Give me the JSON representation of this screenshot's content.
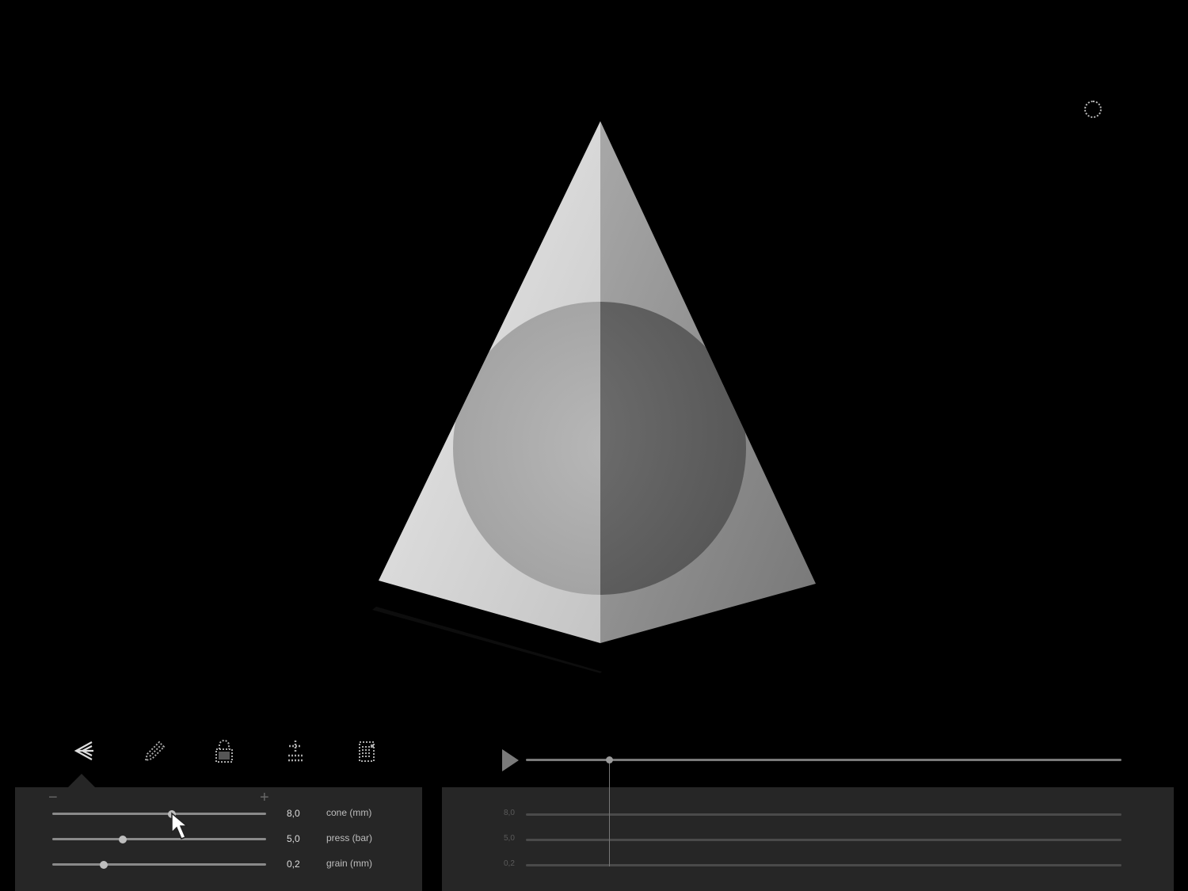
{
  "tools": [
    {
      "name": "back",
      "icon": "back-arrows-icon"
    },
    {
      "name": "pencil",
      "icon": "pencil-icon"
    },
    {
      "name": "lock",
      "icon": "lock-icon"
    },
    {
      "name": "plus-minus",
      "icon": "plus-minus-icon"
    },
    {
      "name": "grid",
      "icon": "grid-icon"
    }
  ],
  "left_panel": {
    "minus_label": "−",
    "plus_label": "+",
    "params": [
      {
        "value": "8,0",
        "label": "cone (mm)",
        "level": 0.56
      },
      {
        "value": "5,0",
        "label": "press (bar)",
        "level": 0.33
      },
      {
        "value": "0,2",
        "label": "grain (mm)",
        "level": 0.24
      }
    ]
  },
  "timeline": {
    "playhead_level": 0.14,
    "track_labels": [
      "8,0",
      "5,0",
      "0,2"
    ]
  },
  "colors": {
    "background": "#000000",
    "panel": "#262626",
    "pyramid_light": "#e0e0e0",
    "pyramid_shadow": "#8c8c8c"
  }
}
